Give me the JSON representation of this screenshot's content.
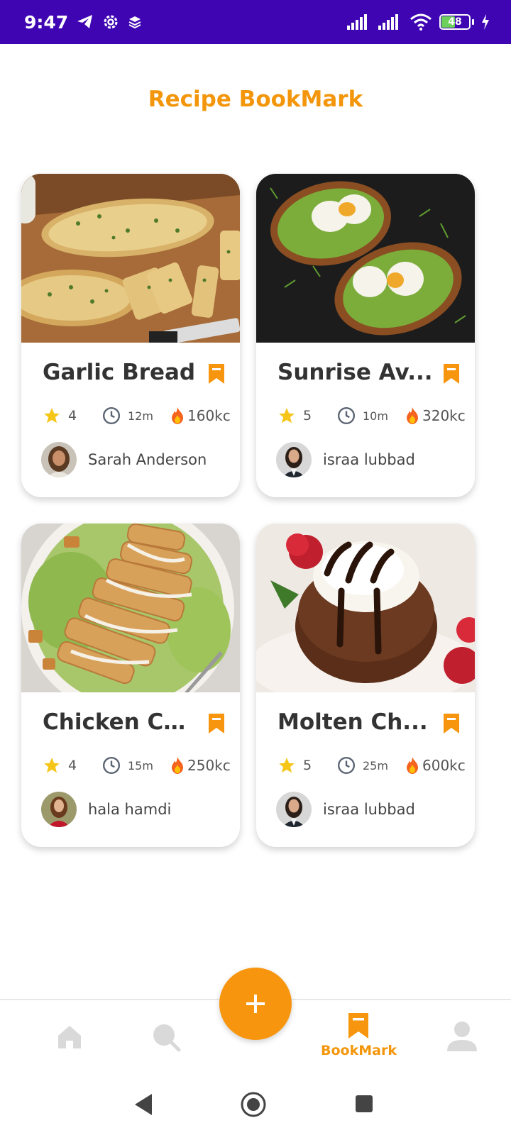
{
  "status_bar": {
    "time": "9:47",
    "battery": "48"
  },
  "page": {
    "title": "Recipe BookMark"
  },
  "recipes": [
    {
      "title": "Garlic Bread",
      "rating": "4",
      "time": "12m",
      "calories": "160kc",
      "author": "Sarah Anderson"
    },
    {
      "title": "Sunrise Av...",
      "rating": "5",
      "time": "10m",
      "calories": "320kc",
      "author": "israa lubbad"
    },
    {
      "title": "Chicken Ca...",
      "rating": "4",
      "time": "15m",
      "calories": "250kc",
      "author": "hala hamdi"
    },
    {
      "title": "Molten Ch...",
      "rating": "5",
      "time": "25m",
      "calories": "600kc",
      "author": "israa lubbad"
    }
  ],
  "nav": {
    "bookmark_label": "BookMark"
  },
  "colors": {
    "accent": "#f3960b",
    "status_bar": "#3f05b3",
    "inactive_icon": "#d9d9d9"
  },
  "icons": {
    "bookmark": "bookmark-icon",
    "star": "star-icon",
    "clock": "clock-icon",
    "fire": "fire-icon",
    "home": "home-icon",
    "search": "search-icon",
    "add": "plus-icon",
    "profile": "profile-icon"
  }
}
